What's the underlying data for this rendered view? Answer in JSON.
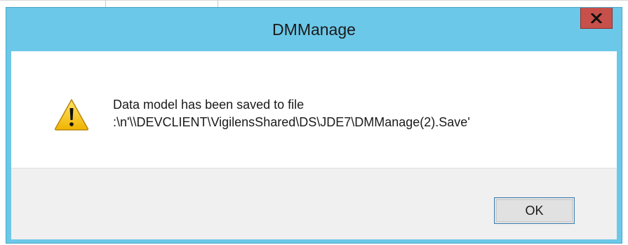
{
  "dialog": {
    "title": "DMManage",
    "close_icon": "close-x-icon",
    "message_icon": "warning-triangle-icon",
    "message_line1": "Data model has been saved to file",
    "message_line2": ":\\n'\\\\DEVCLIENT\\VigilensShared\\DS\\JDE7\\DMManage(2).Save'",
    "ok_label": "OK"
  },
  "colors": {
    "titlebar": "#6cc8e8",
    "close_button": "#c7504b",
    "button_area": "#f0f0f0",
    "warning_fill": "#f5c518"
  }
}
